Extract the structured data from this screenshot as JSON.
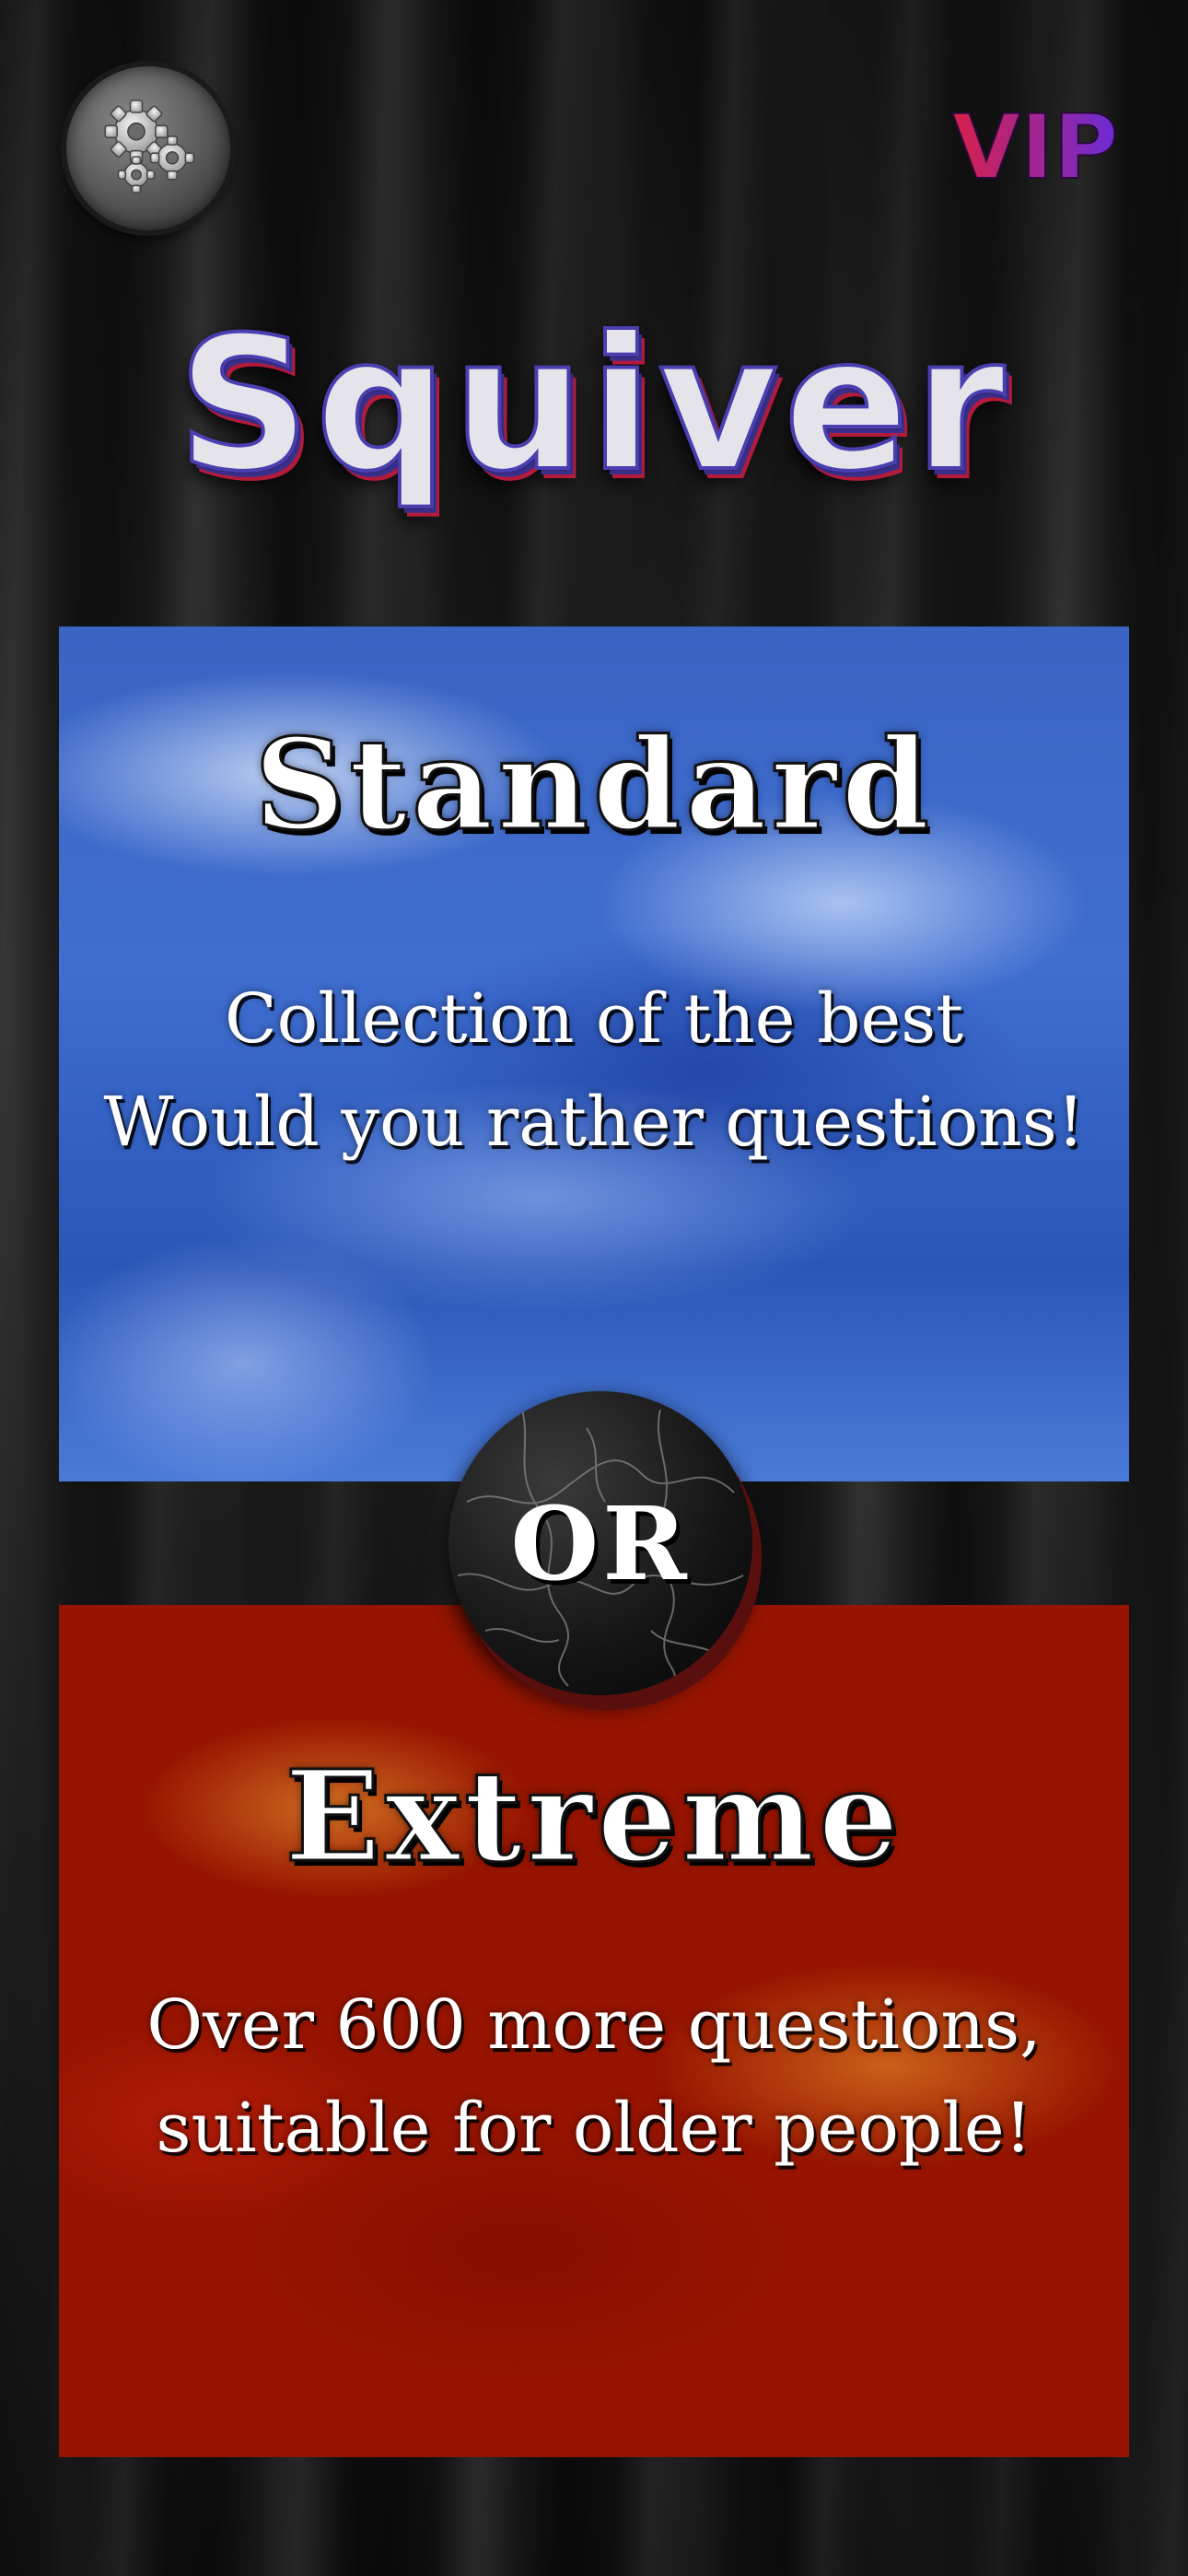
{
  "header": {
    "settings_icon": "gears-icon",
    "vip_label": "VIP",
    "vip_colors": {
      "start": "#d8204a",
      "end": "#6a2bd8"
    }
  },
  "title": "Squiver",
  "modes": {
    "standard": {
      "title": "Standard",
      "description_lines": [
        "Collection of the best",
        "Would you rather questions!"
      ],
      "color": "#3f6ed0"
    },
    "or_label": "OR",
    "extreme": {
      "title": "Extreme",
      "description_lines": [
        "Over 600 more questions,",
        "suitable for older people!"
      ],
      "color": "#d92a14"
    }
  }
}
